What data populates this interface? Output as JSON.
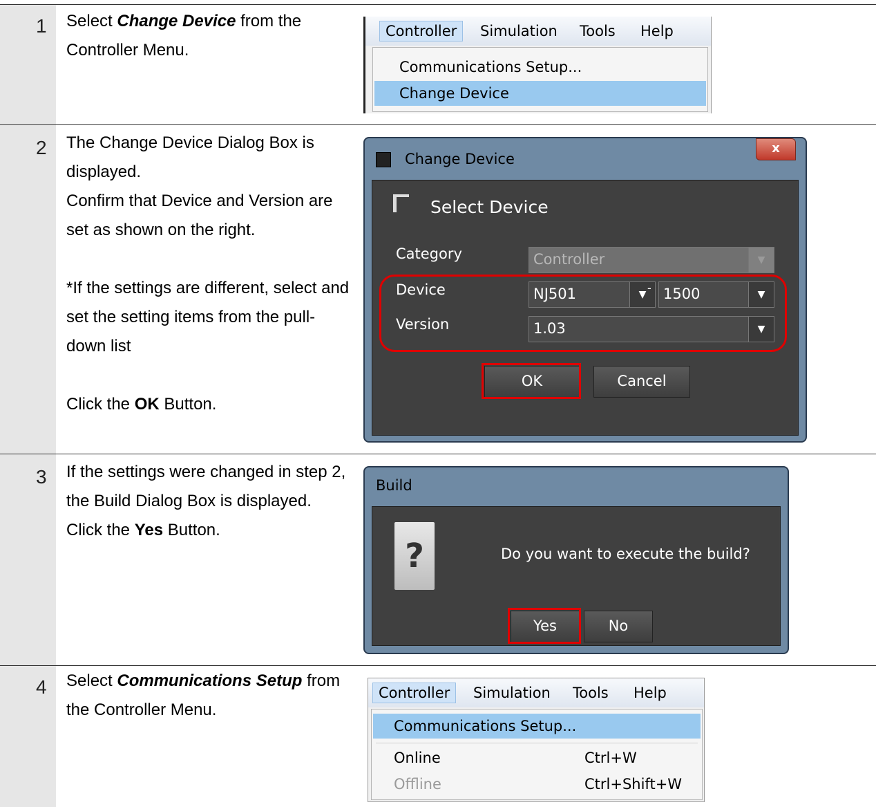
{
  "steps": [
    {
      "num": "1",
      "desc": {
        "pre": "Select ",
        "em": "Change Device",
        "post": " from the Controller Menu."
      }
    },
    {
      "num": "2",
      "desc": {
        "line1": "The Change Device Dialog Box is displayed.",
        "line2": "Confirm that Device and Version are set as shown on the right.",
        "note": "*If the settings are different, select and set the setting items from the pull-down list",
        "click_pre": "Click the ",
        "click_btn": "OK",
        "click_post": " Button."
      }
    },
    {
      "num": "3",
      "desc": {
        "pre": "If the settings were changed in step 2, the Build Dialog Box is displayed. Click the ",
        "btn": "Yes",
        "post": " Button."
      }
    },
    {
      "num": "4",
      "desc": {
        "pre": "Select ",
        "em": "Communications Setup",
        "post": " from the Controller Menu."
      }
    }
  ],
  "menu1": {
    "bar": [
      "Controller",
      "Simulation",
      "Tools",
      "Help"
    ],
    "items": [
      "Communications Setup...",
      "Change Device"
    ]
  },
  "change_device": {
    "title": "Change Device",
    "header": "Select Device",
    "category_label": "Category",
    "category_value": "Controller",
    "device_label": "Device",
    "device_value": "NJ501",
    "device_sep": "-",
    "device_model": "1500",
    "version_label": "Version",
    "version_value": "1.03",
    "ok": "OK",
    "cancel": "Cancel",
    "close": "x"
  },
  "build_dialog": {
    "title": "Build",
    "message": "Do you want to execute the build?",
    "yes": "Yes",
    "no": "No",
    "icon_glyph": "?"
  },
  "menu4": {
    "bar": [
      "Controller",
      "Simulation",
      "Tools",
      "Help"
    ],
    "items": [
      {
        "label": "Communications Setup...",
        "shortcut": ""
      },
      {
        "label": "Online",
        "shortcut": "Ctrl+W"
      },
      {
        "label": "Offline",
        "shortcut": "Ctrl+Shift+W"
      }
    ]
  },
  "colors": {
    "highlight": "#e00000",
    "menu_selected": "#99c9ef",
    "numcol": "#e6e6e6"
  }
}
